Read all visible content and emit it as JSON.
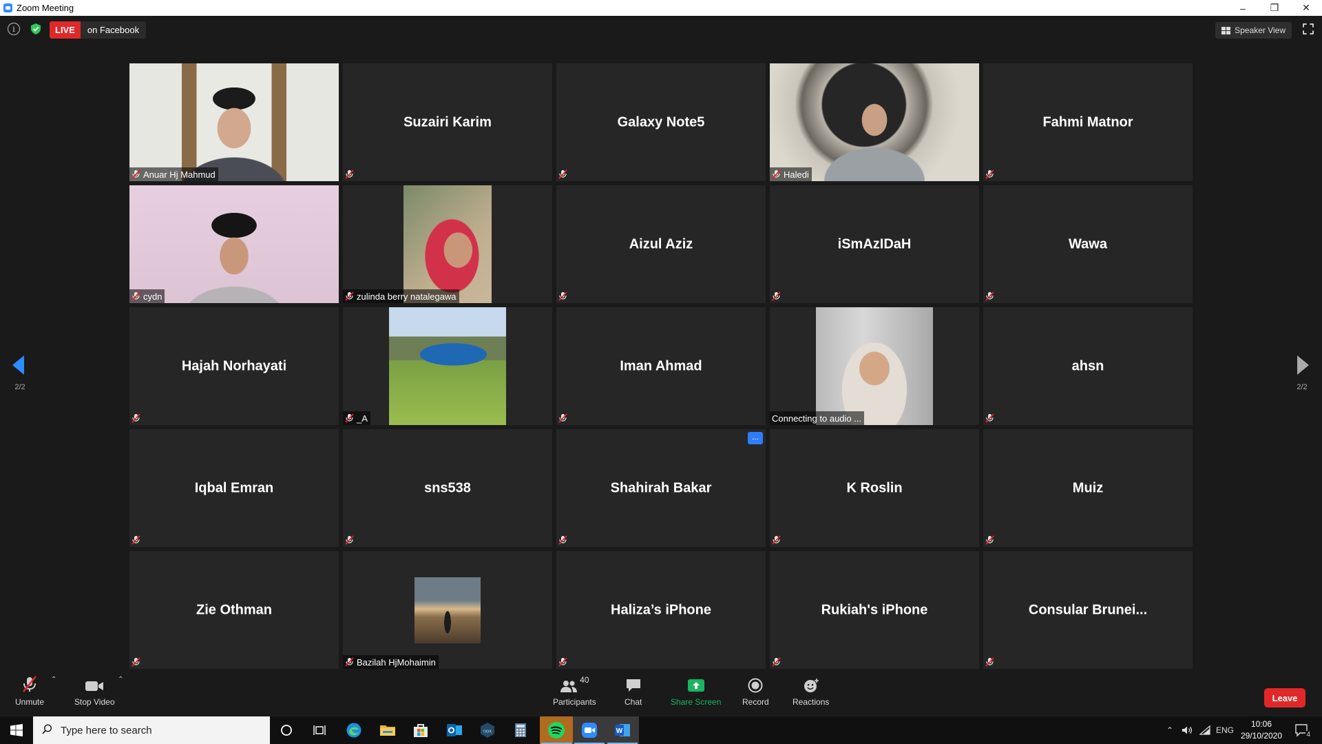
{
  "window": {
    "title": "Zoom Meeting"
  },
  "topbar": {
    "live_label": "LIVE",
    "live_where": "on Facebook",
    "speaker_view_label": "Speaker View"
  },
  "pagination": {
    "left_label": "2/2",
    "right_label": "2/2"
  },
  "tiles": [
    {
      "name": "Anuar Hj Mahmud",
      "video": true,
      "tag": "Anuar Hj Mahmud"
    },
    {
      "name": "Suzairi Karim"
    },
    {
      "name": "Galaxy Note5"
    },
    {
      "name": "Haledi",
      "video": true,
      "tag": "Haledi"
    },
    {
      "name": "Fahmi Matnor"
    },
    {
      "name": "cydn",
      "video": true,
      "tag": "cydn"
    },
    {
      "name": "zulinda berry natalegawa",
      "video": true,
      "tag": "zulinda berry natalegawa"
    },
    {
      "name": "Aizul Aziz"
    },
    {
      "name": "iSmAzIDaH"
    },
    {
      "name": "Wawa"
    },
    {
      "name": "Hajah Norhayati"
    },
    {
      "name": "_A",
      "video": true,
      "tag": "_A"
    },
    {
      "name": "Iman Ahmad"
    },
    {
      "name": "Connecting to audio ...",
      "video": true,
      "tag": "Connecting to audio ..."
    },
    {
      "name": "ahsn"
    },
    {
      "name": "Iqbal Emran"
    },
    {
      "name": "sns538"
    },
    {
      "name": "Shahirah Bakar",
      "menu": "..."
    },
    {
      "name": "K Roslin"
    },
    {
      "name": "Muiz"
    },
    {
      "name": "Zie Othman"
    },
    {
      "name": "Bazilah HjMohaimin",
      "video": true,
      "tag": "Bazilah HjMohaimin"
    },
    {
      "name": "Haliza’s iPhone"
    },
    {
      "name": "Rukiah's iPhone"
    },
    {
      "name": "Consular  Brunei..."
    }
  ],
  "toolbar": {
    "unmute_label": "Unmute",
    "stop_video_label": "Stop Video",
    "participants_label": "Participants",
    "participants_count": "40",
    "chat_label": "Chat",
    "share_label": "Share Screen",
    "record_label": "Record",
    "reactions_label": "Reactions",
    "leave_label": "Leave"
  },
  "taskbar": {
    "search_placeholder": "Type here to search",
    "lang": "ENG",
    "time": "10:06",
    "date": "29/10/2020",
    "notifications": "4"
  },
  "colors": {
    "accent": "#2d8cff",
    "live": "#e02828",
    "share": "#1ab55f",
    "mute": "#e02828"
  }
}
